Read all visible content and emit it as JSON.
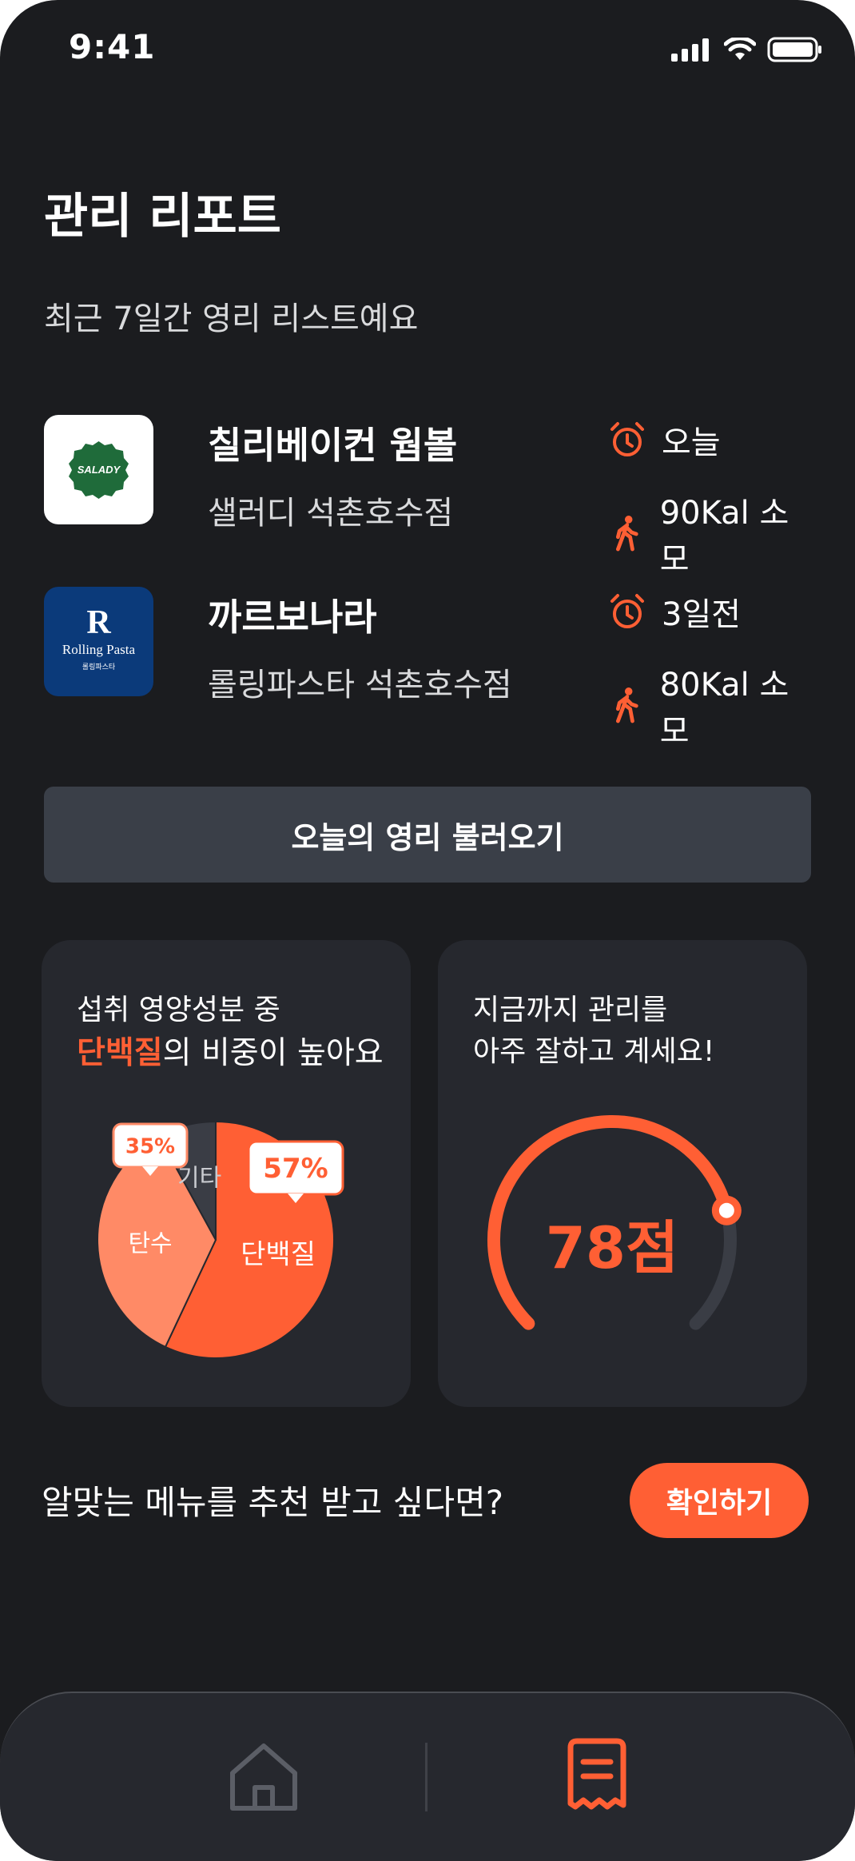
{
  "status_bar": {
    "time": "9:41"
  },
  "header": {
    "title": "관리 리포트",
    "subtitle": "최근 7일간 영리 리스트예요"
  },
  "recent_list": [
    {
      "name": "칠리베이컨 웜볼",
      "store": "샐러디 석촌호수점",
      "logo_text": "SALADY",
      "when": "오늘",
      "calories": "90Kal 소모"
    },
    {
      "name": "까르보나라",
      "store": "롤링파스타 석촌호수점",
      "logo_text": "Rolling Pasta",
      "logo_subtext": "롤링파스타",
      "when": "3일전",
      "calories": "80Kal 소모"
    }
  ],
  "load_button": "오늘의 영리 불러오기",
  "nutrition_card": {
    "line1": "섭취 영양성분 중",
    "highlight": "단백질",
    "line2_rest": "의 비중이 높아요"
  },
  "chart_data": {
    "type": "pie",
    "labels": [
      "단백질",
      "탄수",
      "기타"
    ],
    "values": [
      57,
      35,
      8
    ],
    "data_labels": [
      "57%",
      "35%",
      ""
    ],
    "colors": [
      "#ff5f34",
      "#ff8a66",
      "#3a3d45"
    ]
  },
  "score_card": {
    "line1": "지금까지 관리를",
    "line2": "아주 잘하고 계세요!",
    "score_text": "78점",
    "score": 78
  },
  "recommend": {
    "text": "알맞는 메뉴를 추천 받고 싶다면?",
    "button": "확인하기"
  },
  "bottom_nav": {
    "items": [
      {
        "icon": "home-icon",
        "active": false
      },
      {
        "icon": "receipt-icon",
        "active": true
      }
    ]
  },
  "colors": {
    "background": "#1b1c1f",
    "card": "#26282e",
    "accent": "#ff5f34",
    "accent_light": "#ff8a66",
    "button_gray": "#3a3f48"
  }
}
